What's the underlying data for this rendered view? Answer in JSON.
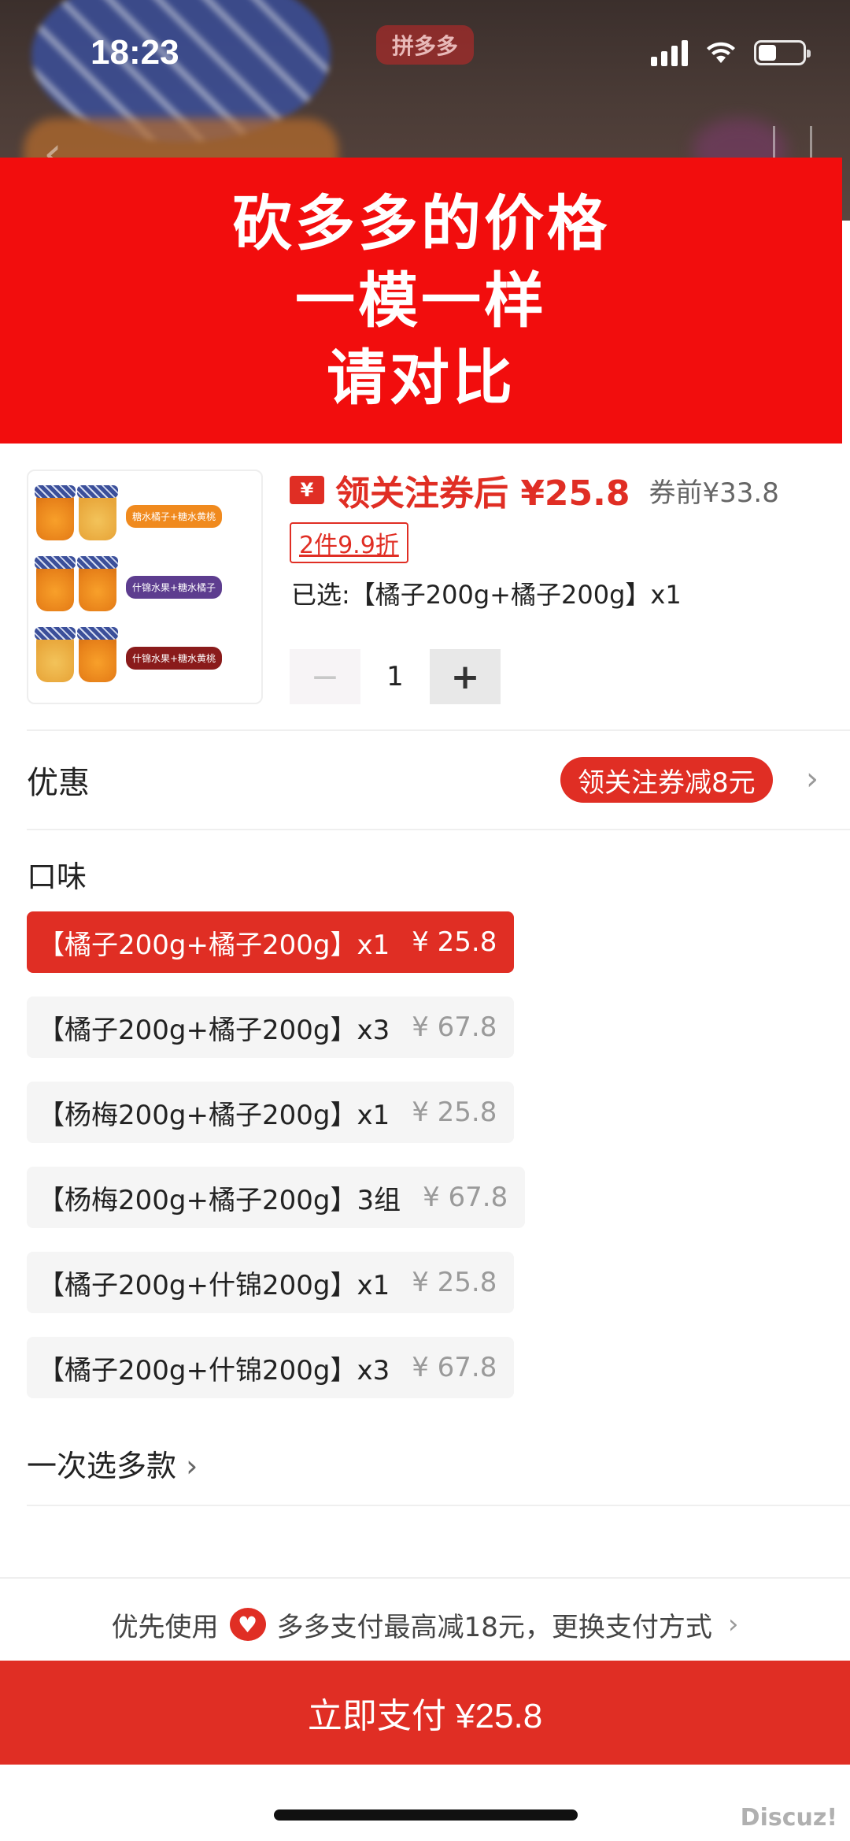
{
  "status_bar": {
    "time": "18:23",
    "app_badge": "拼多多"
  },
  "banner": {
    "lines": [
      "砍多多的价格",
      "一模一样",
      "请对比"
    ]
  },
  "product": {
    "coupon_badge": "¥",
    "price_text": "领关注券后 ¥25.8",
    "old_price": "券前¥33.8",
    "promo_tag": "2件9.9折",
    "selected": "已选:【橘子200g+橘子200g】x1",
    "quantity": "1",
    "thumb_tags": [
      "糖水橘子+糖水黄桃",
      "什锦水果+糖水橘子",
      "什锦水果+糖水黄桃"
    ]
  },
  "discount": {
    "label": "优惠",
    "pill": "领关注券减8元"
  },
  "flavor": {
    "title": "口味",
    "options": [
      {
        "name": "【橘子200g+橘子200g】x1",
        "price": "¥ 25.8"
      },
      {
        "name": "【橘子200g+橘子200g】x3",
        "price": "¥ 67.8"
      },
      {
        "name": "【杨梅200g+橘子200g】x1",
        "price": "¥ 25.8"
      },
      {
        "name": "【杨梅200g+橘子200g】3组",
        "price": "¥ 67.8"
      },
      {
        "name": "【橘子200g+什锦200g】x1",
        "price": "¥ 25.8"
      },
      {
        "name": "【橘子200g+什锦200g】x3",
        "price": "¥ 67.8"
      }
    ],
    "selected_index": 0
  },
  "multi_select": "一次选多款",
  "payment": {
    "tip_prefix": "优先使用",
    "tip_text": "多多支付最高减18元，更换支付方式",
    "pay_button": "立即支付 ¥25.8"
  },
  "watermark": "Discuz!",
  "colors": {
    "accent": "#e02e24",
    "banner": "#f20d0d"
  }
}
